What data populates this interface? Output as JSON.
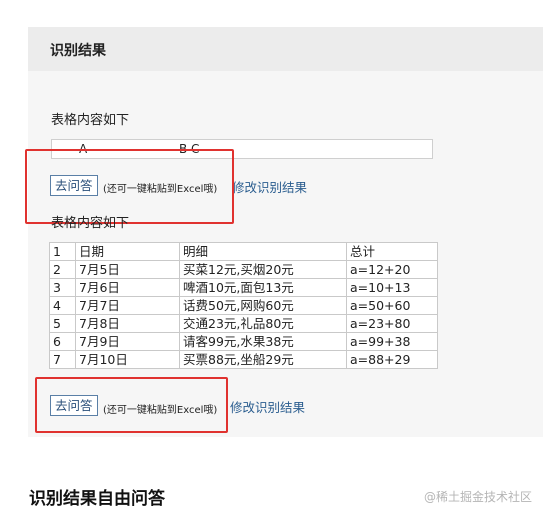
{
  "panel": {
    "title": "识别结果"
  },
  "block1": {
    "caption": "表格内容如下",
    "row": [
      "A",
      "B  C"
    ],
    "ask_button": "去问答",
    "hint": "(还可一键粘贴到Excel哦)",
    "edit_link": "修改识别结果"
  },
  "block2": {
    "caption": "表格内容如下",
    "rows": [
      [
        "1",
        "日期",
        "明细",
        "总计"
      ],
      [
        "2",
        "7月5日",
        "买菜12元,买烟20元",
        "a=12+20"
      ],
      [
        "3",
        "7月6日",
        "啤酒10元,面包13元",
        "a=10+13"
      ],
      [
        "4",
        "7月7日",
        "话费50元,网购60元",
        "a=50+60"
      ],
      [
        "5",
        "7月8日",
        "交通23元,礼品80元",
        "a=23+80"
      ],
      [
        "6",
        "7月9日",
        "请客99元,水果38元",
        "a=99+38"
      ],
      [
        "7",
        "7月10日",
        "买票88元,坐船29元",
        "a=88+29"
      ]
    ],
    "ask_button": "去问答",
    "hint": "(还可一键粘贴到Excel哦)",
    "edit_link": "修改识别结果"
  },
  "section": {
    "title": "识别结果自由问答"
  },
  "watermark": "@稀土掘金技术社区",
  "colors": {
    "highlight": "#e0322f",
    "link": "#2a5d8f"
  }
}
